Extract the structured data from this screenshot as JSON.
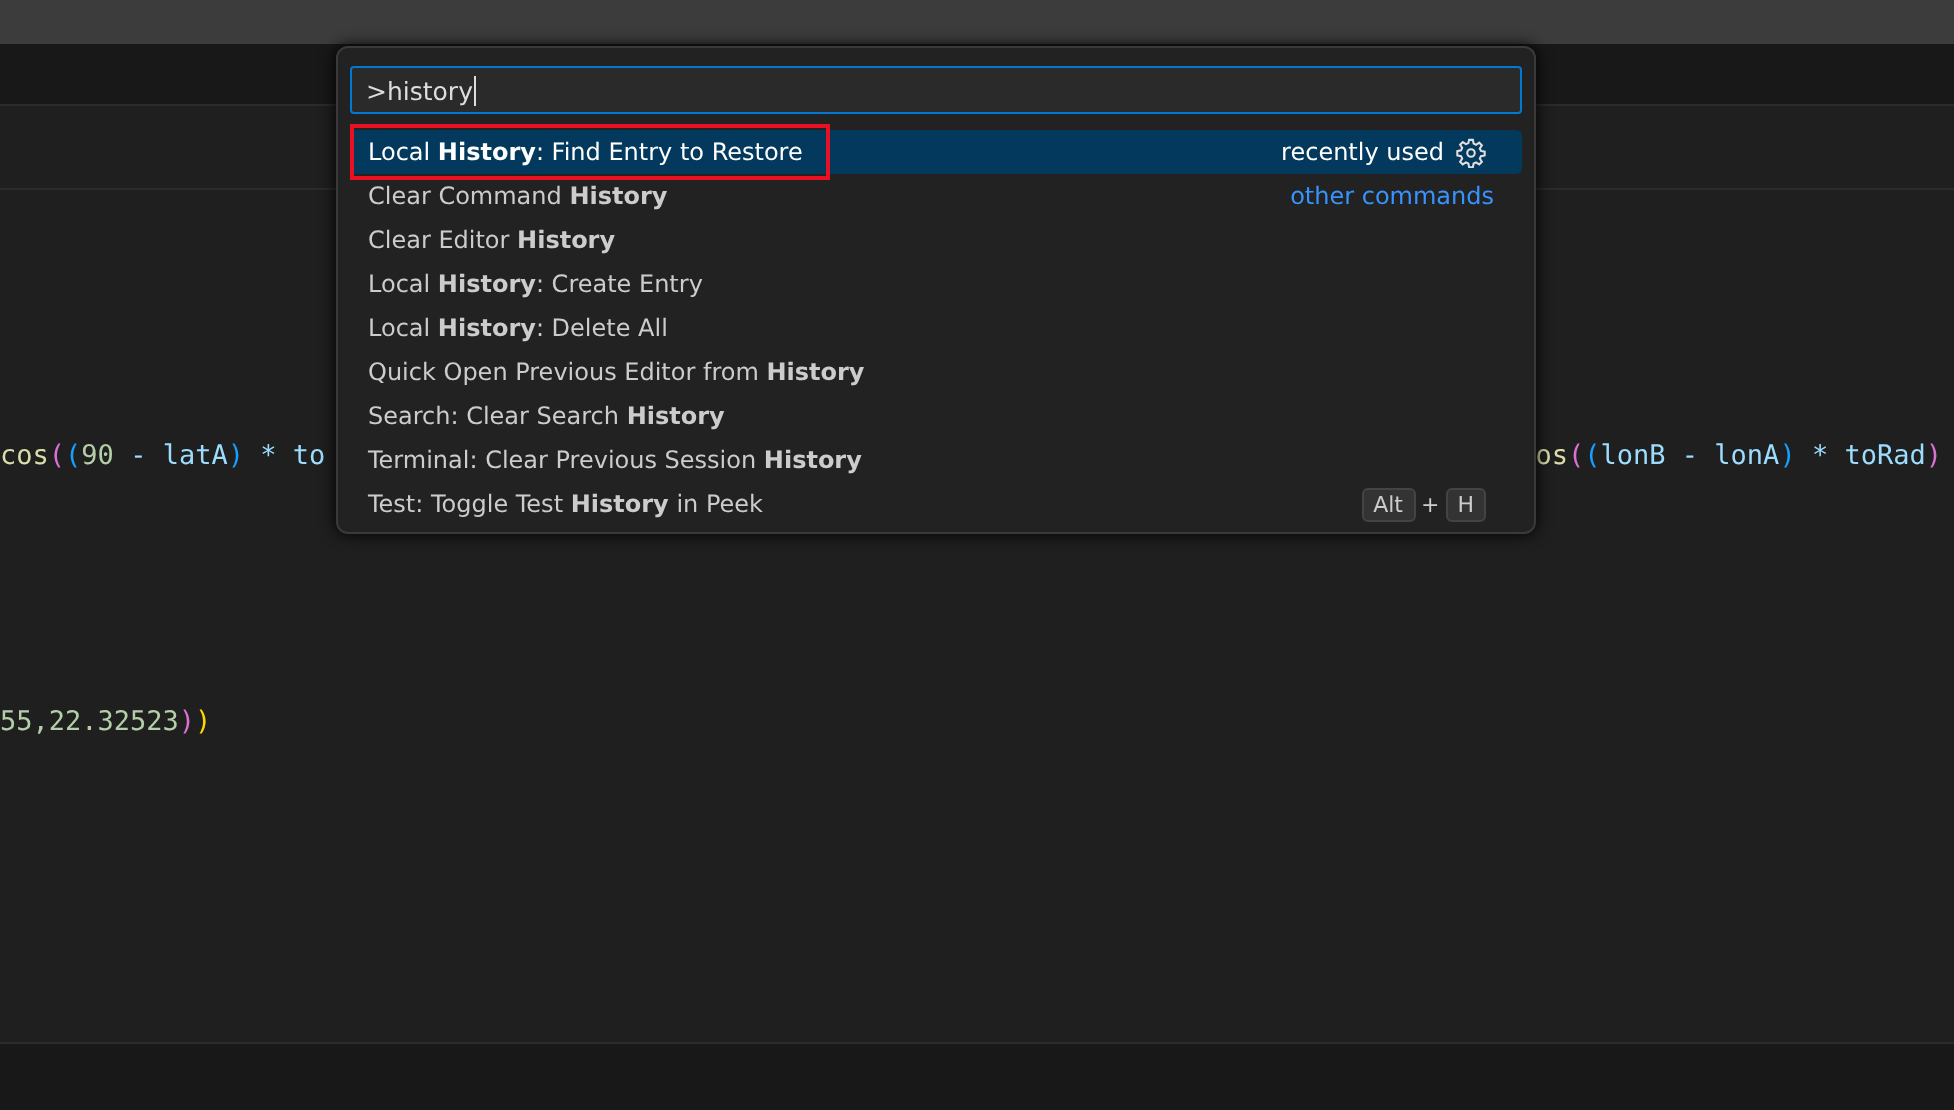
{
  "palette": {
    "query": ">history",
    "items": [
      {
        "label": "Local **History**: Find Entry to Restore",
        "selected": true,
        "highlighted": true,
        "hint": "recently used",
        "kind": "plain",
        "gear": true
      },
      {
        "label": "Clear Command **History**",
        "selected": false,
        "highlighted": false,
        "hint": "other commands",
        "kind": "link",
        "gear": false
      },
      {
        "label": "Clear Editor **History**",
        "selected": false,
        "highlighted": false,
        "gear": false
      },
      {
        "label": "Local **History**: Create Entry",
        "selected": false,
        "highlighted": false,
        "gear": false
      },
      {
        "label": "Local **History**: Delete All",
        "selected": false,
        "highlighted": false,
        "gear": false
      },
      {
        "label": "Quick Open Previous Editor from **History**",
        "selected": false,
        "highlighted": false,
        "gear": false
      },
      {
        "label": "Search: Clear Search **History**",
        "selected": false,
        "highlighted": false,
        "gear": false
      },
      {
        "label": "Terminal: Clear Previous Session **History**",
        "selected": false,
        "highlighted": false,
        "gear": false
      },
      {
        "label": "Test: Toggle Test **History** in Peek",
        "selected": false,
        "highlighted": false,
        "gear": false,
        "keys": [
          "Alt",
          "+",
          "H"
        ]
      }
    ]
  },
  "editor": {
    "lines": [
      {
        "left": [
          {
            "text": "cos",
            "kind": "func"
          },
          {
            "text": "(",
            "kind": "b1"
          },
          {
            "text": "(",
            "kind": "b2"
          },
          {
            "text": "90",
            "kind": "num"
          },
          {
            "text": " - latA",
            "kind": "var"
          },
          {
            "text": ")",
            "kind": "b2"
          },
          {
            "text": " * to",
            "kind": "var"
          }
        ],
        "right": [
          {
            "text": "os",
            "kind": "func"
          },
          {
            "text": "(",
            "kind": "b1"
          },
          {
            "text": "(",
            "kind": "b2"
          },
          {
            "text": "lonB - lonA",
            "kind": "var"
          },
          {
            "text": ")",
            "kind": "b2"
          },
          {
            "text": " * toRad",
            "kind": "var"
          },
          {
            "text": ")",
            "kind": "b1"
          }
        ]
      },
      {
        "left": [
          {
            "text": "55,22.32523",
            "kind": "num"
          },
          {
            "text": ")",
            "kind": "b1"
          },
          {
            "text": ")",
            "kind": "b0"
          }
        ]
      }
    ]
  }
}
